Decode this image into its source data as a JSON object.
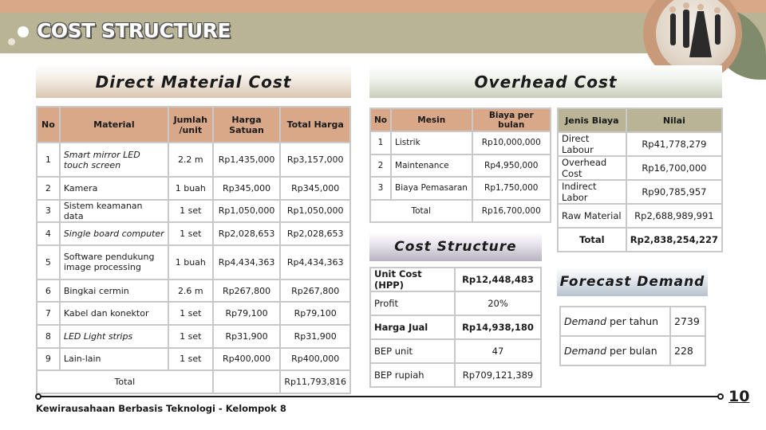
{
  "slide": {
    "title": "COST STRUCTURE",
    "footer": "Kewirausahaan Berbasis Teknologi - Kelompok 8",
    "page_number": "10"
  },
  "direct_material": {
    "heading": "Direct Material Cost",
    "headers": [
      "No",
      "Material",
      "Jumlah /unit",
      "Harga Satuan",
      "Total Harga"
    ],
    "rows": [
      {
        "no": "1",
        "material": "Smart mirror LED touch screen",
        "jumlah": "2.2 m",
        "harga": "Rp1,435,000",
        "total": "Rp3,157,000"
      },
      {
        "no": "2",
        "material": "Kamera",
        "jumlah": "1 buah",
        "harga": "Rp345,000",
        "total": "Rp345,000"
      },
      {
        "no": "3",
        "material": "Sistem keamanan data",
        "jumlah": "1 set",
        "harga": "Rp1,050,000",
        "total": "Rp1,050,000"
      },
      {
        "no": "4",
        "material": "Single board computer",
        "jumlah": "1 set",
        "harga": "Rp2,028,653",
        "total": "Rp2,028,653"
      },
      {
        "no": "5",
        "material": "Software pendukung image processing",
        "jumlah": "1 buah",
        "harga": "Rp4,434,363",
        "total": "Rp4,434,363"
      },
      {
        "no": "6",
        "material": "Bingkai cermin",
        "jumlah": "2.6 m",
        "harga": "Rp267,800",
        "total": "Rp267,800"
      },
      {
        "no": "7",
        "material": "Kabel dan konektor",
        "jumlah": "1 set",
        "harga": "Rp79,100",
        "total": "Rp79,100"
      },
      {
        "no": "8",
        "material": "LED Light strips",
        "jumlah": "1 set",
        "harga": "Rp31,900",
        "total": "Rp31,900"
      },
      {
        "no": "9",
        "material": "Lain-lain",
        "jumlah": "1 set",
        "harga": "Rp400,000",
        "total": "Rp400,000"
      }
    ],
    "total_label": "Total",
    "total_value": "Rp11,793,816"
  },
  "overhead": {
    "heading": "Overhead Cost",
    "mesin_headers": [
      "No",
      "Mesin",
      "Biaya per bulan"
    ],
    "mesin_rows": [
      {
        "no": "1",
        "mesin": "Listrik",
        "biaya": "Rp10,000,000"
      },
      {
        "no": "2",
        "mesin": "Maintenance",
        "biaya": "Rp4,950,000"
      },
      {
        "no": "3",
        "mesin": "Biaya Pemasaran",
        "biaya": "Rp1,750,000"
      }
    ],
    "mesin_total_label": "Total",
    "mesin_total_value": "Rp16,700,000",
    "biaya_headers": [
      "Jenis Biaya",
      "Nilai"
    ],
    "biaya_rows": [
      {
        "jenis": "Direct Labour",
        "nilai": "Rp41,778,279"
      },
      {
        "jenis": "Overhead Cost",
        "nilai": "Rp16,700,000"
      },
      {
        "jenis": "Indirect Labor",
        "nilai": "Rp90,785,957"
      },
      {
        "jenis": "Raw Material",
        "nilai": "Rp2,688,989,991"
      }
    ],
    "biaya_total_label": "Total",
    "biaya_total_value": "Rp2,838,254,227"
  },
  "cost_structure": {
    "heading": "Cost Structure",
    "rows": [
      {
        "label": "Unit Cost (HPP)",
        "value": "Rp12,448,483",
        "bold": true
      },
      {
        "label": "Profit",
        "value": "20%",
        "bold": false
      },
      {
        "label": "Harga Jual",
        "value": "Rp14,938,180",
        "bold": true
      },
      {
        "label": "BEP unit",
        "value": "47",
        "bold": false
      },
      {
        "label": "BEP rupiah",
        "value": "Rp709,121,389",
        "bold": false
      }
    ]
  },
  "forecast": {
    "heading": "Forecast Demand",
    "rows": [
      {
        "label_italic": "Demand",
        "label_rest": " per tahun",
        "value": "2739"
      },
      {
        "label_italic": "Demand",
        "label_rest": " per bulan",
        "value": "228"
      }
    ]
  },
  "colors": {
    "top_band": "#d9a888",
    "title_band": "#b9b495",
    "material_header": "#d9a888",
    "biaya_header": "#b9b495"
  }
}
